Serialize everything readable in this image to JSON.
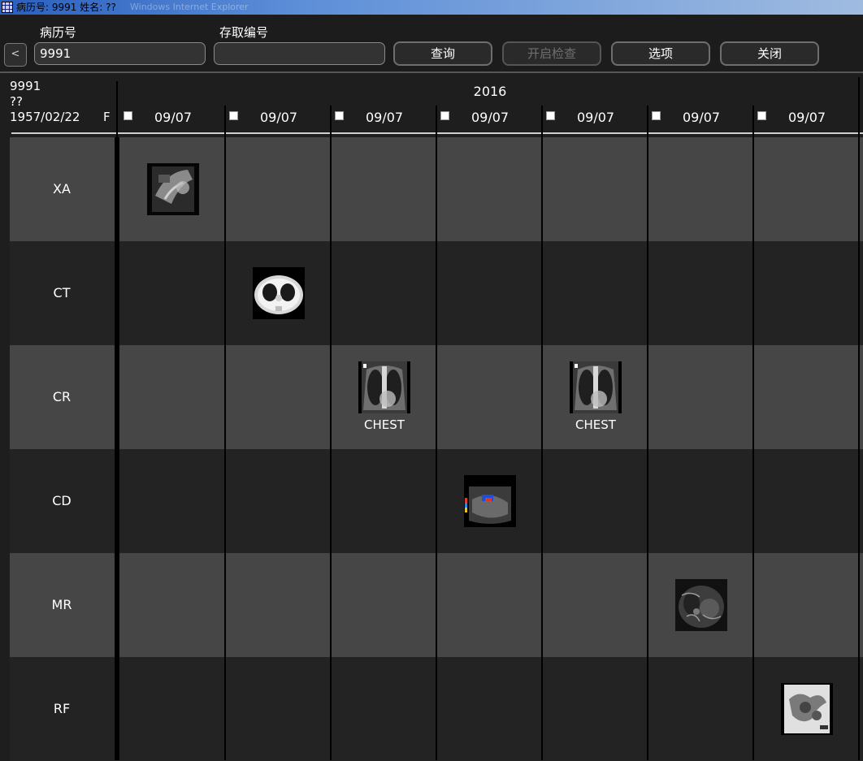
{
  "window": {
    "title": "病历号: 9991 姓名: ??",
    "title_ghost": "Windows Internet Explorer"
  },
  "toolbar": {
    "record_label": "病历号",
    "access_label": "存取编号",
    "back_label": "<",
    "record_value": "9991",
    "access_value": "",
    "query_label": "查询",
    "open_exam_label": "开启检查",
    "options_label": "选项",
    "close_label": "关闭"
  },
  "patient": {
    "id": "9991",
    "name": "??",
    "dob": "1957/02/22",
    "sex": "F"
  },
  "timeline": {
    "year": "2016",
    "dates": [
      "09/07",
      "09/07",
      "09/07",
      "09/07",
      "09/07",
      "09/07",
      "09/07"
    ]
  },
  "rows": [
    {
      "modality": "XA"
    },
    {
      "modality": "CT"
    },
    {
      "modality": "CR"
    },
    {
      "modality": "CD"
    },
    {
      "modality": "MR"
    },
    {
      "modality": "RF"
    }
  ],
  "studies": [
    {
      "row": 0,
      "col": 0,
      "kind": "xa-angio-thumbnail",
      "label": ""
    },
    {
      "row": 1,
      "col": 1,
      "kind": "ct-chest-thumbnail",
      "label": ""
    },
    {
      "row": 2,
      "col": 2,
      "kind": "cr-chest-xray-thumbnail",
      "label": "CHEST"
    },
    {
      "row": 2,
      "col": 4,
      "kind": "cr-chest-xray-thumbnail",
      "label": "CHEST"
    },
    {
      "row": 3,
      "col": 3,
      "kind": "color-doppler-ultrasound-thumbnail",
      "label": ""
    },
    {
      "row": 4,
      "col": 5,
      "kind": "mr-abdomen-thumbnail",
      "label": ""
    },
    {
      "row": 5,
      "col": 6,
      "kind": "rf-fluoroscopy-thumbnail",
      "label": ""
    }
  ]
}
